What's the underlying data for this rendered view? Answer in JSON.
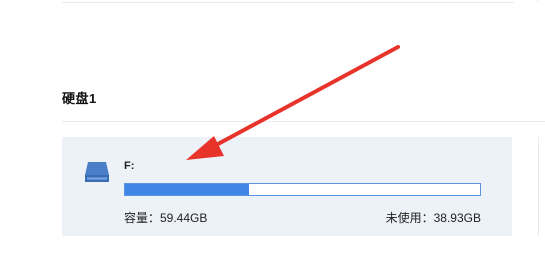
{
  "section": {
    "title": "硬盘1"
  },
  "drive": {
    "letter": "F:",
    "icon": "hard-drive-icon",
    "used_fraction": 0.35,
    "capacity_text": "容量：59.44GB",
    "free_text": "未使用：38.93GB"
  },
  "colors": {
    "card_background": "#edf2f8",
    "bar_fill": "#3f86e6",
    "bar_border": "#5a93e0",
    "arrow": "#e8332a"
  }
}
